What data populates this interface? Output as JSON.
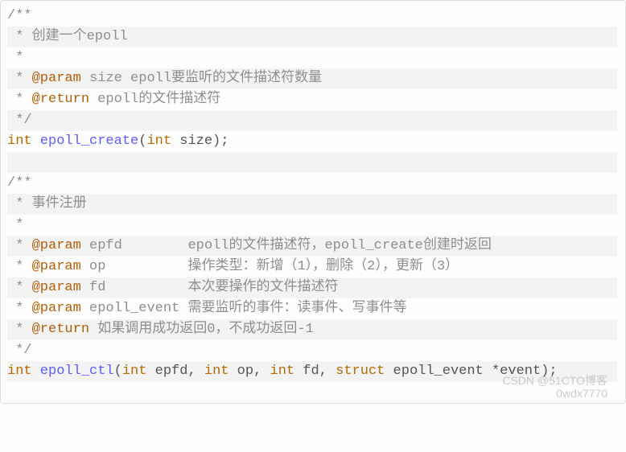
{
  "block1": {
    "open": "/**",
    "l1": " * 创建一个epoll",
    "l2": " *",
    "l3_pre": " * ",
    "l3_tag": "@param",
    "l3_rest": " size epoll要监听的文件描述符数量",
    "l4_pre": " * ",
    "l4_tag": "@return",
    "l4_rest": " epoll的文件描述符",
    "close": " */",
    "sig_kw1": "int",
    "sig_fn": " epoll_create",
    "sig_paren1": "(",
    "sig_kw2": "int",
    "sig_rest": " size);"
  },
  "block2": {
    "open": "/**",
    "l1": " * 事件注册",
    "l2": " *",
    "p1_pre": " * ",
    "p1_tag": "@param",
    "p1_name": " epfd        ",
    "p1_desc": "epoll的文件描述符，epoll_create创建时返回",
    "p2_pre": " * ",
    "p2_tag": "@param",
    "p2_name": " op          ",
    "p2_desc": "操作类型：新增（1），删除（2），更新（3）",
    "p3_pre": " * ",
    "p3_tag": "@param",
    "p3_name": " fd          ",
    "p3_desc": "本次要操作的文件描述符",
    "p4_pre": " * ",
    "p4_tag": "@param",
    "p4_name": " epoll_event ",
    "p4_desc": "需要监听的事件：读事件、写事件等",
    "r_pre": " * ",
    "r_tag": "@return",
    "r_desc": " 如果调用成功返回0，不成功返回-1",
    "close": " */",
    "sig_kw1": "int",
    "sig_fn": " epoll_ctl",
    "sig_paren1": "(",
    "sig_kw2": "int",
    "sig_a": " epfd, ",
    "sig_kw3": "int",
    "sig_b": " op, ",
    "sig_kw4": "int",
    "sig_c": " fd, ",
    "sig_kw5": "struct",
    "sig_d": " epoll_event *event);"
  },
  "watermark": {
    "l1": "CSDN @51CTO博客",
    "l2": "0wdx7770"
  }
}
